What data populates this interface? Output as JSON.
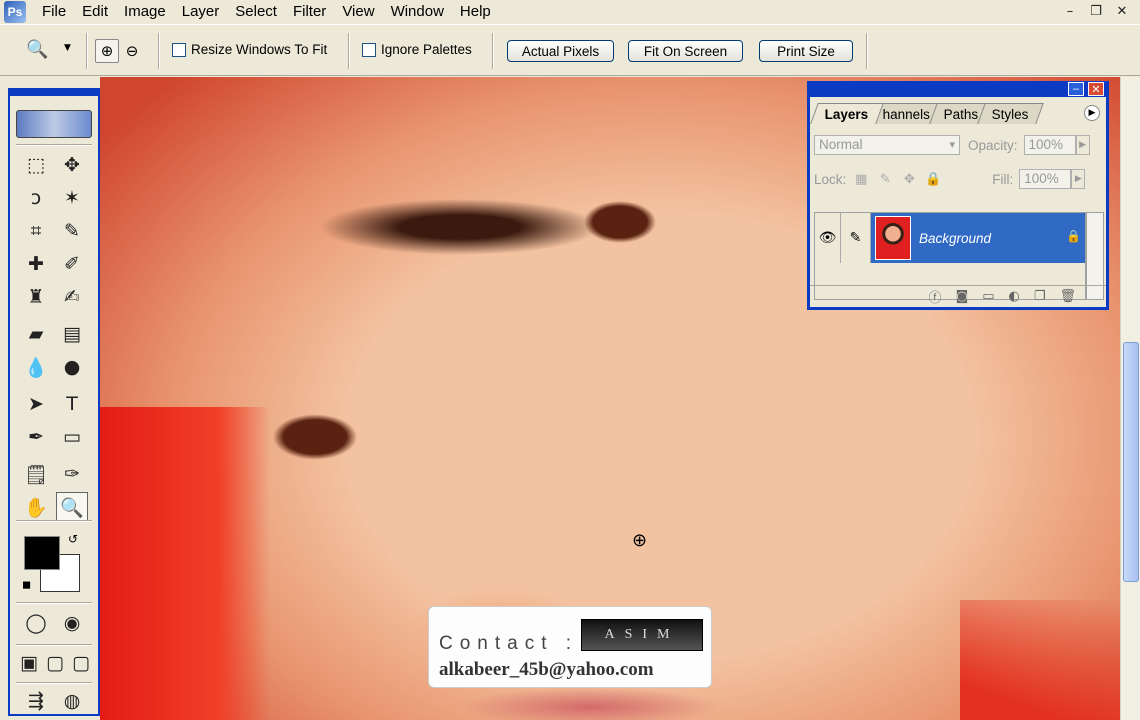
{
  "app": {
    "icon": "photoshop-logo-icon",
    "icon_text": "Ps"
  },
  "menu": [
    "File",
    "Edit",
    "Image",
    "Layer",
    "Select",
    "Filter",
    "View",
    "Window",
    "Help"
  ],
  "window_controls": {
    "minimize": "–",
    "restore": "❐",
    "close": "✕"
  },
  "options": {
    "zoom_tool_glyph": "🔍",
    "zoom_in_glyph": "⊕",
    "zoom_out_glyph": "⊖",
    "resize_windows_label": "Resize Windows To Fit",
    "resize_windows_checked": false,
    "ignore_palettes_label": "Ignore Palettes",
    "ignore_palettes_checked": false,
    "actual_pixels": "Actual Pixels",
    "fit_on_screen": "Fit On Screen",
    "print_size": "Print Size"
  },
  "toolbox": {
    "tools": [
      {
        "name": "rect-marquee",
        "glyph": "⬚"
      },
      {
        "name": "move",
        "glyph": "✥"
      },
      {
        "name": "lasso",
        "glyph": "ↄ"
      },
      {
        "name": "magic-wand",
        "glyph": "✶"
      },
      {
        "name": "crop",
        "glyph": "⌗"
      },
      {
        "name": "slice",
        "glyph": "✎"
      },
      {
        "name": "healing",
        "glyph": "✚"
      },
      {
        "name": "brush",
        "glyph": "✐"
      },
      {
        "name": "clone-stamp",
        "glyph": "♜"
      },
      {
        "name": "history-brush",
        "glyph": "✍"
      },
      {
        "name": "eraser",
        "glyph": "▰"
      },
      {
        "name": "gradient",
        "glyph": "▤"
      },
      {
        "name": "blur",
        "glyph": "💧"
      },
      {
        "name": "dodge",
        "glyph": "●"
      },
      {
        "name": "path-select",
        "glyph": "➤"
      },
      {
        "name": "type",
        "glyph": "T"
      },
      {
        "name": "pen",
        "glyph": "✒"
      },
      {
        "name": "shape",
        "glyph": "▭"
      },
      {
        "name": "notes",
        "glyph": "🗒"
      },
      {
        "name": "eyedropper",
        "glyph": "✑"
      },
      {
        "name": "hand",
        "glyph": "✋"
      },
      {
        "name": "zoom",
        "glyph": "🔍"
      }
    ],
    "foreground": "#000000",
    "background": "#ffffff"
  },
  "layers_panel": {
    "tabs": [
      "Layers",
      "Channels",
      "Paths",
      "Styles"
    ],
    "tabs_display": [
      "Layers",
      "hannels",
      "Paths",
      "Styles"
    ],
    "active_tab": "Layers",
    "blend_mode": "Normal",
    "opacity_label": "Opacity:",
    "opacity": "100%",
    "lock_label": "Lock:",
    "fill_label": "Fill:",
    "fill": "100%",
    "layer_name": "Background"
  },
  "watermark": {
    "contact_label": "Contact :",
    "badge": "ASIM",
    "email": "alkabeer_45b@yahoo.com"
  }
}
